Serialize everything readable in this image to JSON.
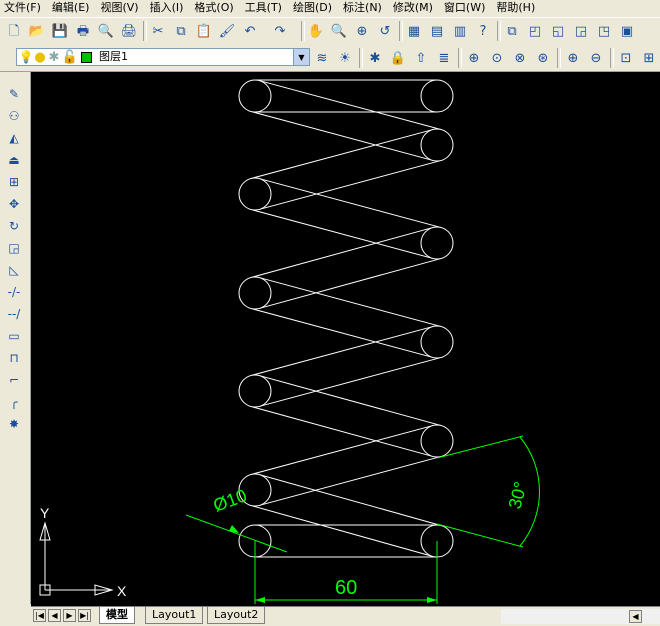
{
  "menu": [
    "文件(F)",
    "编辑(E)",
    "视图(V)",
    "插入(I)",
    "格式(O)",
    "工具(T)",
    "绘图(D)",
    "标注(N)",
    "修改(M)",
    "窗口(W)",
    "帮助(H)"
  ],
  "layer": {
    "current": "图层1"
  },
  "colors": {
    "canvas": "#000000",
    "geometry": "#ffffff",
    "dimension": "#00ff00"
  },
  "drawing": {
    "dim_diameter": "Ø10",
    "dim_length": "60",
    "dim_angle": "30°",
    "ucs_x": "X",
    "ucs_y": "Y"
  },
  "tabs": [
    "模型",
    "Layout1",
    "Layout2"
  ],
  "active_tab": "模型",
  "icons": {
    "toolbar1": [
      "new-icon",
      "open-icon",
      "save-icon",
      "print-icon",
      "print-preview-icon",
      "publish-icon",
      "cut-icon",
      "copy-icon",
      "paste-icon",
      "match-properties-icon",
      "undo-icon",
      "redo-icon",
      "pan-icon",
      "zoom-realtime-icon",
      "zoom-window-icon",
      "zoom-previous-icon",
      "properties-icon",
      "design-center-icon",
      "tool-palettes-icon",
      "help-icon",
      "named-views-icon",
      "top-view-icon",
      "bottom-view-icon",
      "left-view-icon",
      "right-view-icon",
      "front-view-icon"
    ],
    "toolbar2": [
      "layer-manager-icon",
      "layer-on-icon",
      "layer-freeze-icon",
      "layer-lock-icon",
      "make-object-layer-current-icon",
      "layer-previous-icon",
      "zoom-window-icon",
      "zoom-dynamic-icon",
      "zoom-scale-icon",
      "zoom-center-icon",
      "zoom-in-icon",
      "zoom-out-icon",
      "zoom-all-icon",
      "zoom-extents-icon"
    ],
    "modify": [
      "erase-icon",
      "copy-object-icon",
      "mirror-icon",
      "offset-icon",
      "array-icon",
      "move-icon",
      "rotate-icon",
      "scale-icon",
      "stretch-icon",
      "trim-icon",
      "extend-icon",
      "break-icon",
      "join-icon",
      "chamfer-icon",
      "fillet-icon",
      "explode-icon"
    ]
  }
}
